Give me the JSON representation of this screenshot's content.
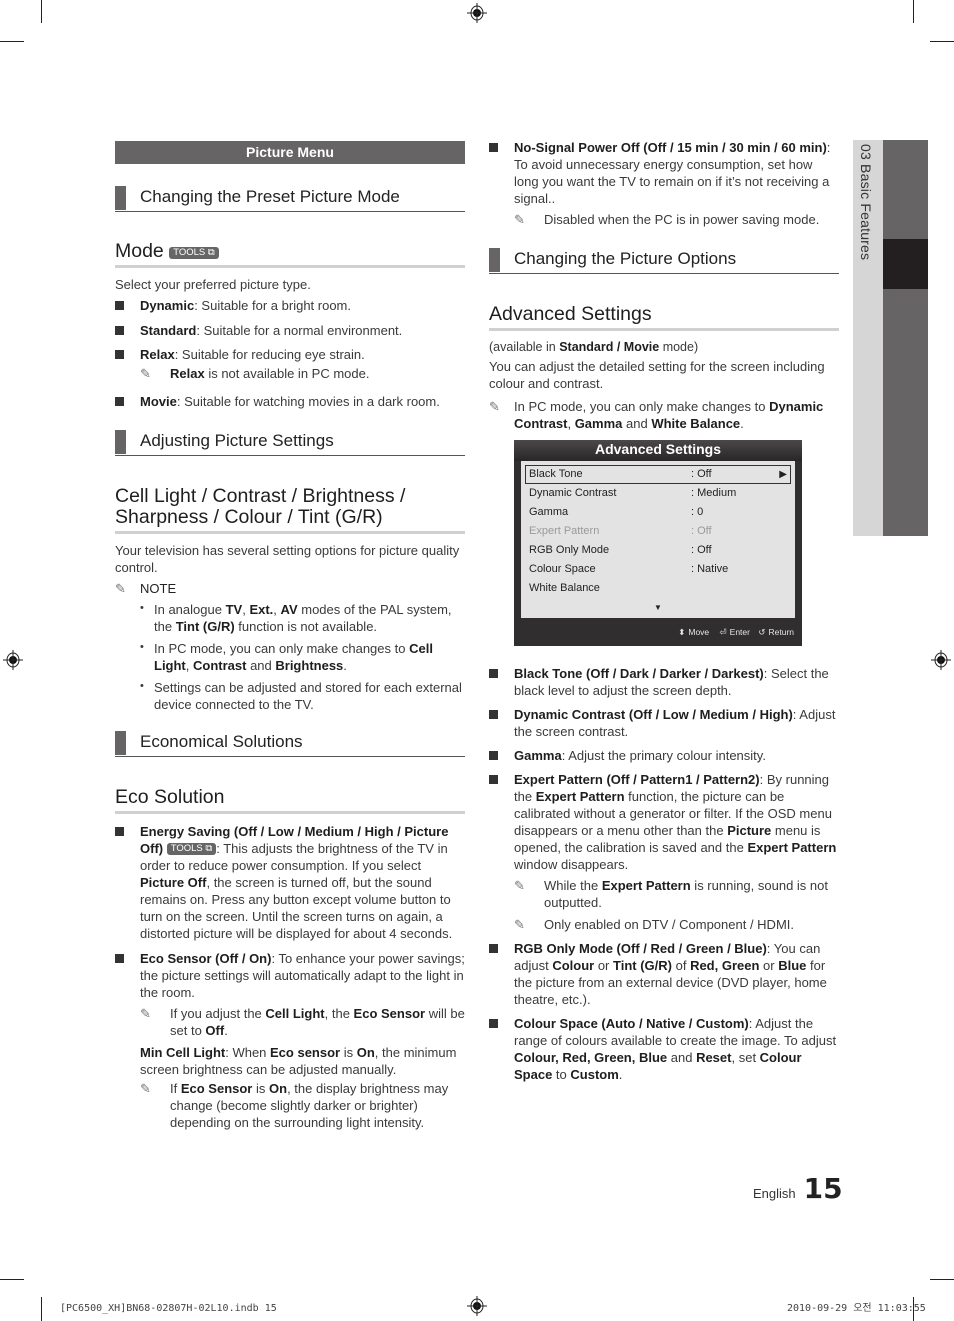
{
  "left": {
    "menu_bar": "Picture Menu",
    "sub1": "Changing the Preset Picture Mode",
    "mode_title": "Mode",
    "tools_label": "TOOLS",
    "mode_intro": "Select your preferred picture type.",
    "modes": [
      {
        "name": "Dynamic",
        "desc": ": Suitable for a bright room."
      },
      {
        "name": "Standard",
        "desc": ": Suitable for a normal environment."
      },
      {
        "name": "Relax",
        "desc": ": Suitable for reducing eye strain."
      },
      {
        "name": "Movie",
        "desc": ": Suitable for watching movies in a dark room."
      }
    ],
    "relax_note_b": "Relax",
    "relax_note": " is not available in PC mode.",
    "sub2": "Adjusting Picture Settings",
    "cell_title_1": "Cell Light / Contrast / Brightness /",
    "cell_title_2": "Sharpness / Colour / Tint (G/R)",
    "cell_intro": "Your television has several setting options for picture quality control.",
    "note_label": "NOTE",
    "notes": [
      {
        "t1": "In analogue ",
        "b1": "TV",
        "t2": ", ",
        "b2": "Ext.",
        "t3": ", ",
        "b3": "AV",
        "t4": " modes of the PAL system, the ",
        "b4": "Tint (G/R)",
        "t5": " function is not available."
      },
      {
        "t1": "In PC mode, you can only make changes to ",
        "b1": "Cell Light",
        "t2": ", ",
        "b2": "Contrast",
        "t3": " and ",
        "b3": "Brightness",
        "t4": "."
      },
      {
        "t1": "Settings can be adjusted and stored for each external device connected to the TV."
      }
    ],
    "sub3": "Economical Solutions",
    "eco_title": "Eco Solution",
    "energy": {
      "b1": "Energy Saving (Off / Low / Medium / High / Picture Off)",
      "t1": ": This adjusts the brightness of the TV in order to reduce power consumption. If you select ",
      "b2": "Picture Off",
      "t2": ", the screen is turned off, but the sound remains on. Press any button except volume button to turn on the screen. Until the screen turns on again, a distorted picture will be displayed for about 4 seconds."
    },
    "sensor": {
      "b1": "Eco Sensor (Off / On)",
      "t1": ": To enhance your power savings; the picture settings will automatically adapt to the light in the room."
    },
    "sensor_note": {
      "t1": "If you adjust the ",
      "b1": "Cell Light",
      "t2": ", the ",
      "b2": "Eco Sensor",
      "t3": " will be set to ",
      "b3": "Off",
      "t4": "."
    },
    "min_cell": {
      "b1": "Min Cell Light",
      "t1": ": When ",
      "b2": "Eco sensor",
      "t2": " is ",
      "b3": "On",
      "t3": ", the minimum screen brightness can be adjusted manually."
    },
    "min_note": {
      "t1": "If ",
      "b1": "Eco Sensor",
      "t2": " is ",
      "b2": "On",
      "t3": ", the display brightness may change (become slightly darker or brighter) depending on the surrounding light intensity."
    }
  },
  "right": {
    "nosignal": {
      "b1": "No-Signal Power Off (Off / 15 min / 30 min / 60 min)",
      "t1": ": To avoid unnecessary energy consumption, set how long you want the TV to remain on if it’s not receiving a signal.."
    },
    "nosignal_note": "Disabled when the PC is in power saving mode.",
    "sub4": "Changing the Picture Options",
    "adv_title": "Advanced Settings",
    "adv_avail": {
      "t1": "(available in ",
      "b1": "Standard / Movie",
      "t2": " mode)"
    },
    "adv_intro": "You can adjust the detailed setting for the screen including colour and contrast.",
    "adv_note": {
      "t1": "In PC mode, you can only make changes to ",
      "b1": "Dynamic Contrast",
      "t2": ", ",
      "b2": "Gamma",
      "t3": " and ",
      "b3": "White Balance",
      "t4": "."
    },
    "osd": {
      "title": "Advanced Settings",
      "rows": [
        {
          "label": "Black Tone",
          "value": ": Off"
        },
        {
          "label": "Dynamic Contrast",
          "value": ": Medium"
        },
        {
          "label": "Gamma",
          "value": ": 0"
        },
        {
          "label": "Expert Pattern",
          "value": ": Off"
        },
        {
          "label": "RGB Only Mode",
          "value": ": Off"
        },
        {
          "label": "Colour Space",
          "value": ": Native"
        },
        {
          "label": "White Balance",
          "value": ""
        }
      ],
      "footer": {
        "move": "Move",
        "enter": "Enter",
        "return": "Return"
      }
    },
    "items": {
      "black": {
        "b1": "Black Tone (Off / Dark / Darker / Darkest)",
        "t1": ": Select the black level to adjust the screen depth."
      },
      "dyn": {
        "b1": "Dynamic Contrast (Off / Low / Medium / High)",
        "t1": ": Adjust the screen contrast."
      },
      "gamma": {
        "b1": "Gamma",
        "t1": ": Adjust the primary colour intensity."
      },
      "expert": {
        "b1": "Expert Pattern (Off / Pattern1 / Pattern2)",
        "t1": ": By running the ",
        "b2": "Expert Pattern",
        "t2": " function, the picture can be calibrated without a generator or filter. If the OSD menu disappears or a menu other than the ",
        "b3": "Picture",
        "t3": " menu is opened, the calibration is saved and the ",
        "b4": "Expert Pattern",
        "t4": " window disappears."
      },
      "expert_note1": {
        "t1": "While the ",
        "b1": "Expert Pattern",
        "t2": " is running, sound is not outputted."
      },
      "expert_note2": "Only enabled on DTV / Component / HDMI.",
      "rgb": {
        "b1": "RGB Only Mode (Off / Red / Green / Blue)",
        "t1": ": You can adjust ",
        "b2": "Colour",
        "t2": " or ",
        "b3": "Tint (G/R)",
        "t3": " of ",
        "b4": "Red, Green",
        "t4": " or ",
        "b5": "Blue",
        "t5": " for the picture from an external device (DVD player, home theatre, etc.)."
      },
      "cspace": {
        "b1": "Colour Space (Auto / Native / Custom)",
        "t1": ": Adjust the range of colours available to create the image. To adjust ",
        "b2": "Colour, Red, Green, Blue",
        "t2": " and ",
        "b3": "Reset",
        "t3": ", set ",
        "b4": "Colour Space",
        "t4": " to ",
        "b5": "Custom",
        "t5": "."
      }
    }
  },
  "side_tab": "03  Basic Features",
  "footer": {
    "lang": "English",
    "page": "15"
  },
  "slug": {
    "left": "[PC6500_XH]BN68-02807H-02L10.indb   15",
    "right": "2010-09-29   오전 11:03:55"
  }
}
